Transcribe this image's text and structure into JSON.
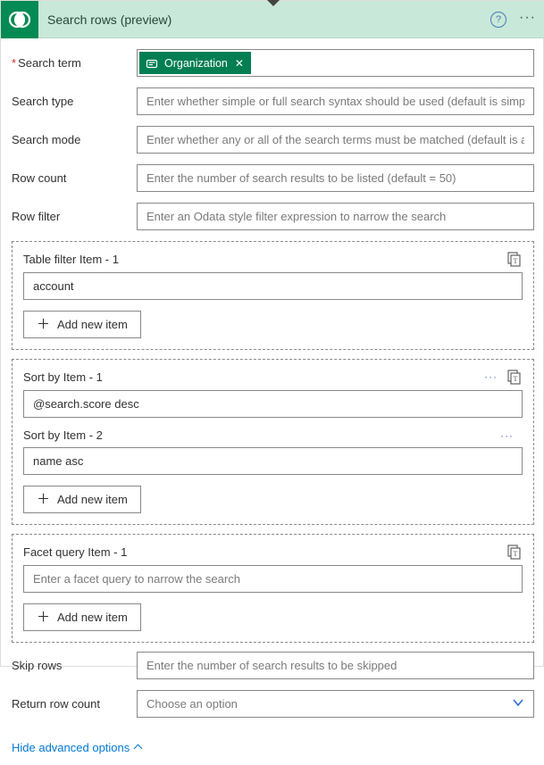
{
  "header": {
    "title": "Search rows (preview)"
  },
  "fields": {
    "search_term": {
      "label": "Search term",
      "required": true,
      "token": "Organization"
    },
    "search_type": {
      "label": "Search type",
      "placeholder": "Enter whether simple or full search syntax should be used (default is simple)"
    },
    "search_mode": {
      "label": "Search mode",
      "placeholder": "Enter whether any or all of the search terms must be matched (default is any)"
    },
    "row_count": {
      "label": "Row count",
      "placeholder": "Enter the number of search results to be listed (default = 50)"
    },
    "row_filter": {
      "label": "Row filter",
      "placeholder": "Enter an Odata style filter expression to narrow the search"
    },
    "skip_rows": {
      "label": "Skip rows",
      "placeholder": "Enter the number of search results to be skipped"
    },
    "return_row_count": {
      "label": "Return row count",
      "placeholder": "Choose an option"
    }
  },
  "groups": {
    "table_filter": {
      "items": [
        {
          "label": "Table filter Item - 1",
          "value": "account",
          "placeholder": ""
        }
      ],
      "add_label": "Add new item"
    },
    "sort_by": {
      "items": [
        {
          "label": "Sort by Item - 1",
          "value": "@search.score desc",
          "placeholder": ""
        },
        {
          "label": "Sort by Item - 2",
          "value": "name asc",
          "placeholder": ""
        }
      ],
      "add_label": "Add new item"
    },
    "facet_query": {
      "items": [
        {
          "label": "Facet query Item - 1",
          "value": "",
          "placeholder": "Enter a facet query to narrow the search"
        }
      ],
      "add_label": "Add new item"
    }
  },
  "footer": {
    "toggle_label": "Hide advanced options"
  }
}
